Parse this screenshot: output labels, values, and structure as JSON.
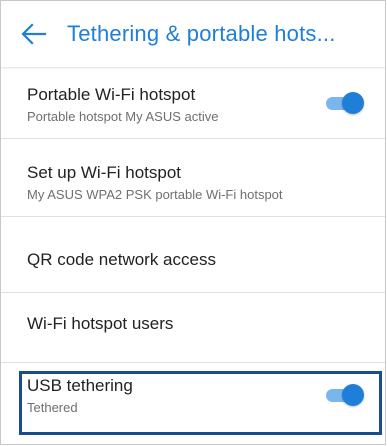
{
  "header": {
    "title": "Tethering & portable hots..."
  },
  "items": [
    {
      "primary": "Portable Wi-Fi hotspot",
      "secondary": "Portable hotspot My ASUS active",
      "toggle_on": true
    },
    {
      "primary": "Set up Wi-Fi hotspot",
      "secondary": "My ASUS WPA2 PSK portable Wi-Fi hotspot"
    },
    {
      "primary": "QR code network access"
    },
    {
      "primary": "Wi-Fi hotspot users"
    },
    {
      "primary": "USB tethering",
      "secondary": "Tethered",
      "toggle_on": true
    }
  ],
  "colors": {
    "accent": "#1f7ed8",
    "track": "#7ab6ee",
    "highlight": "#1a4d8f"
  }
}
